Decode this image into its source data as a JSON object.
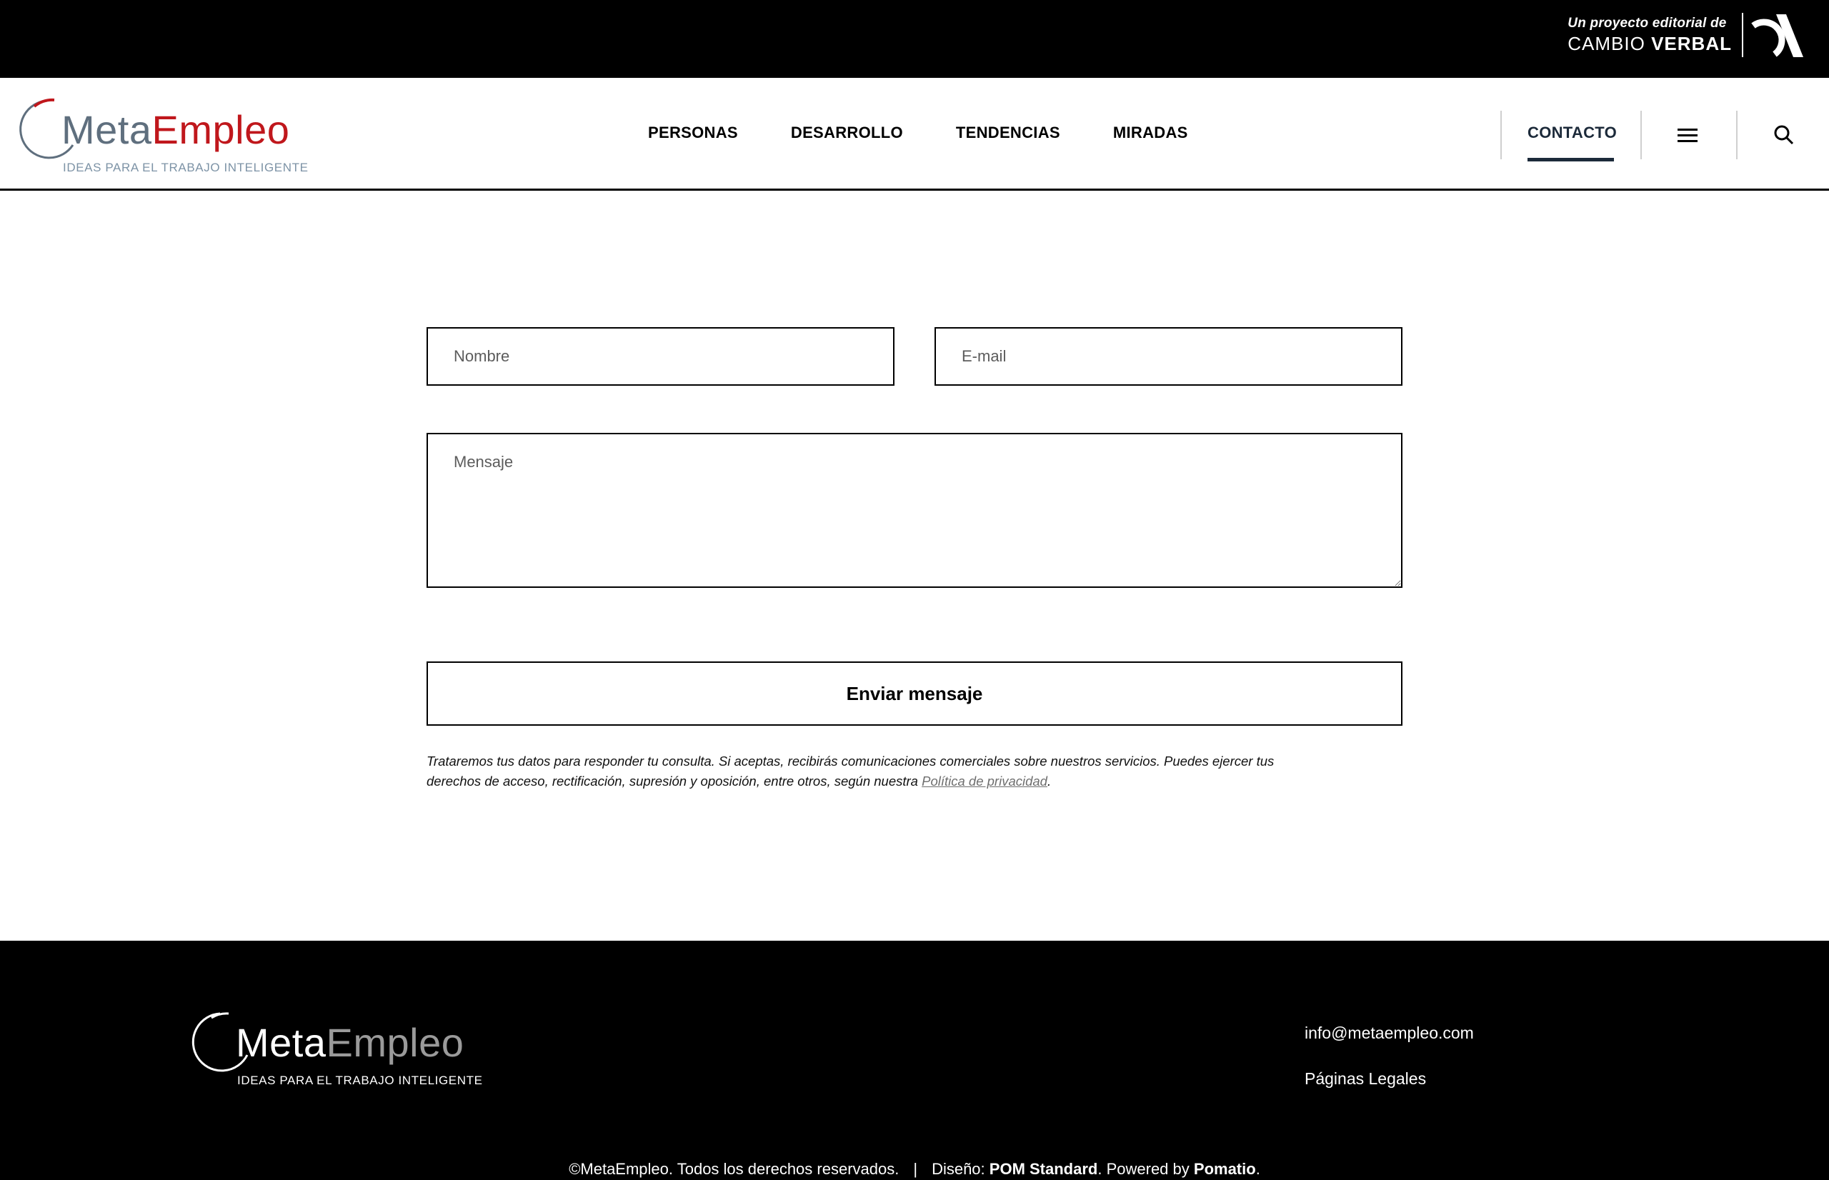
{
  "topbar": {
    "pre": "Un proyecto editorial de",
    "brand_light": "CAMBIO",
    "brand_bold": "VERBAL"
  },
  "header": {
    "logo_meta": "Meta",
    "logo_empleo": "Empleo",
    "logo_tagline": "IDEAS PARA EL TRABAJO INTELIGENTE",
    "nav": [
      "PERSONAS",
      "DESARROLLO",
      "TENDENCIAS",
      "MIRADAS"
    ],
    "contact": "CONTACTO",
    "menu_icon": "hamburger-icon",
    "search_icon": "search-icon"
  },
  "form": {
    "name_placeholder": "Nombre",
    "email_placeholder": "E-mail",
    "message_placeholder": "Mensaje",
    "submit_label": "Enviar mensaje",
    "legal_line1": "Trataremos tus datos para responder tu consulta. Si aceptas, recibirás comunicaciones comerciales sobre nuestros servicios. Puedes ejercer tus",
    "legal_line2": "derechos de acceso, rectificación, supresión y oposición, entre otros, según nuestra",
    "privacy_link": "Política de privacidad",
    "legal_end": "."
  },
  "footer": {
    "logo_meta": "Meta",
    "logo_empleo": "Empleo",
    "logo_tagline": "IDEAS PARA EL TRABAJO INTELIGENTE",
    "email": "info@metaempleo.com",
    "legal_pages": "Páginas Legales",
    "copyright": "©MetaEmpleo. Todos los derechos reservados.",
    "separator": "|",
    "design_label": "Diseño:",
    "design_by": "POM Standard",
    "powered_label": ". Powered by",
    "powered_by": "Pomatio",
    "end": "."
  },
  "colors": {
    "brand_red": "#c0171c",
    "brand_grey": "#5f6f7e",
    "contact_navy": "#1c2a3a"
  }
}
